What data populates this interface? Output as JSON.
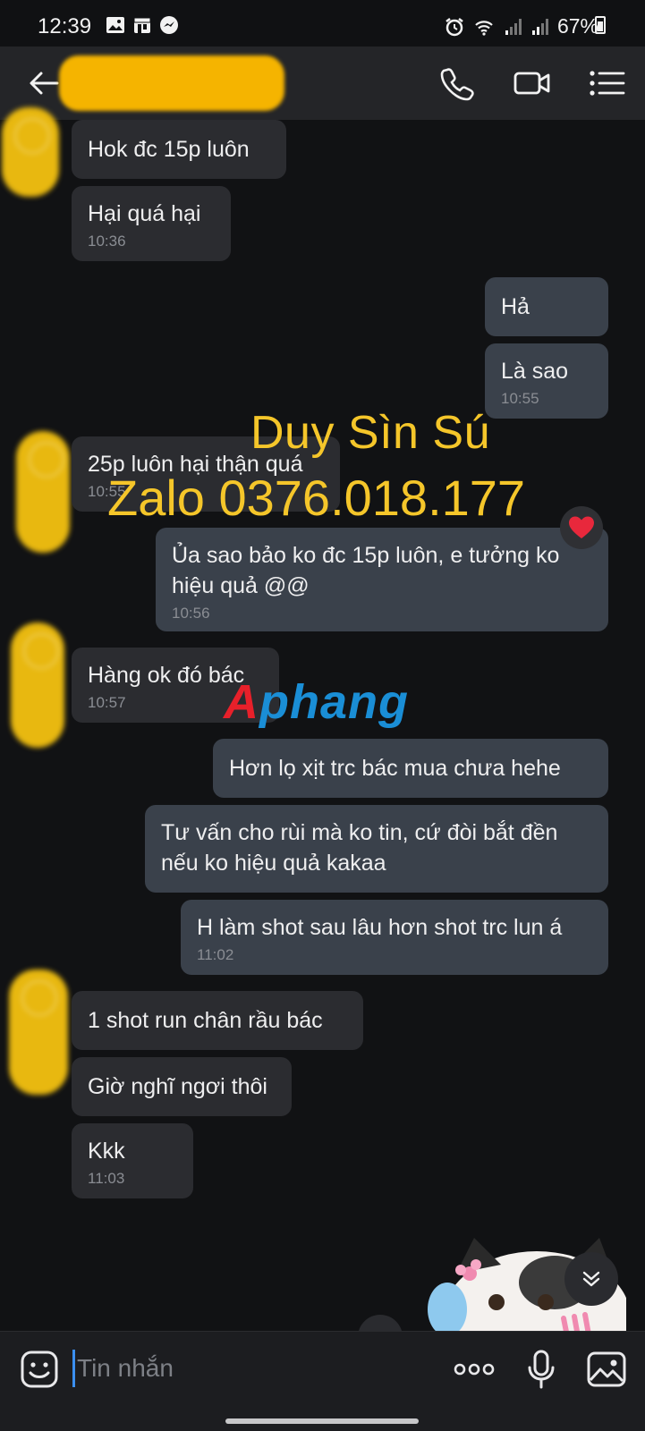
{
  "status_bar": {
    "time": "12:39",
    "battery_percent": "67%",
    "left_icons": [
      "gallery-icon",
      "store-icon",
      "messenger-icon"
    ],
    "right_icons": [
      "alarm-icon",
      "wifi-icon",
      "signal-icon",
      "signal-icon",
      "battery-icon"
    ]
  },
  "header": {
    "contact_name": "",
    "icons": [
      "back-arrow-icon",
      "phone-icon",
      "video-camera-icon",
      "list-menu-icon"
    ]
  },
  "messages": [
    {
      "side": "in",
      "text": "Hok đc 15p luôn",
      "time": ""
    },
    {
      "side": "in",
      "text": "Hại quá hại",
      "time": "10:36"
    },
    {
      "side": "out",
      "text": "Hả",
      "time": ""
    },
    {
      "side": "out",
      "text": "Là sao",
      "time": "10:55"
    },
    {
      "side": "in",
      "text": "25p luôn hại thận quá",
      "time": "10:55"
    },
    {
      "side": "out",
      "text_line1": "Ủa sao bảo ko đc 15p luôn, e tưởng ko",
      "text_line2": "hiệu quả @@",
      "time": "10:56",
      "reaction": "❤️"
    },
    {
      "side": "in",
      "text": "Hàng ok đó bác",
      "time": "10:57"
    },
    {
      "side": "out",
      "text": "Hơn lọ xịt trc bác mua chưa  hehe",
      "time": ""
    },
    {
      "side": "out",
      "text_line1": "Tư vấn cho rùi mà ko tin, cứ đòi bắt đền",
      "text_line2": "nếu ko hiệu quả kakaa",
      "time": ""
    },
    {
      "side": "out",
      "text": "H làm shot sau lâu hơn shot trc lun á",
      "time": "11:02"
    },
    {
      "side": "in",
      "text": "1 shot run chân rầu bác",
      "time": ""
    },
    {
      "side": "in",
      "text": "Giờ nghĩ ngơi thôi",
      "time": ""
    },
    {
      "side": "in",
      "text": "Kkk",
      "time": "11:03"
    }
  ],
  "watermark": {
    "line1": "Duy Sìn Sú",
    "line2": "Zalo 0376.018.177",
    "brand_first": "A",
    "brand_rest": "phang"
  },
  "composer": {
    "placeholder": "Tin nhắn",
    "icons": [
      "emoji-icon",
      "more-options-icon",
      "microphone-icon",
      "image-icon"
    ]
  },
  "colors": {
    "background": "#111214",
    "bubble_in": "#2b2c30",
    "bubble_out": "#3a414b",
    "watermark": "#f5c62a",
    "accent": "#3b8ff0"
  }
}
